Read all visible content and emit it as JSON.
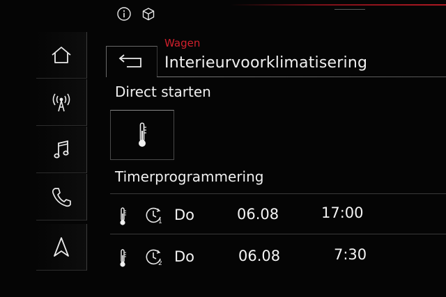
{
  "status_bar": {
    "icons": [
      "info-icon",
      "cube-icon"
    ]
  },
  "sidebar": {
    "items": [
      {
        "icon": "home-icon"
      },
      {
        "icon": "radio-antenna-icon"
      },
      {
        "icon": "music-note-icon"
      },
      {
        "icon": "phone-icon"
      },
      {
        "icon": "navigation-arrow-icon"
      }
    ]
  },
  "header": {
    "back_icon": "back-arrow-icon",
    "breadcrumb": "Wagen",
    "title": "Interieurvoorklimatisering"
  },
  "direct_start": {
    "label": "Direct starten",
    "button_icon": "thermometer-icon"
  },
  "timers": {
    "label": "Timerprogrammering",
    "rows": [
      {
        "timer_number": "1",
        "day": "Do",
        "date": "06.08",
        "time": "17:00"
      },
      {
        "timer_number": "2",
        "day": "Do",
        "date": "06.08",
        "time": "7:30"
      }
    ]
  },
  "colors": {
    "background": "#050505",
    "accent_red": "#d0202c",
    "text": "#f0f0f0"
  }
}
